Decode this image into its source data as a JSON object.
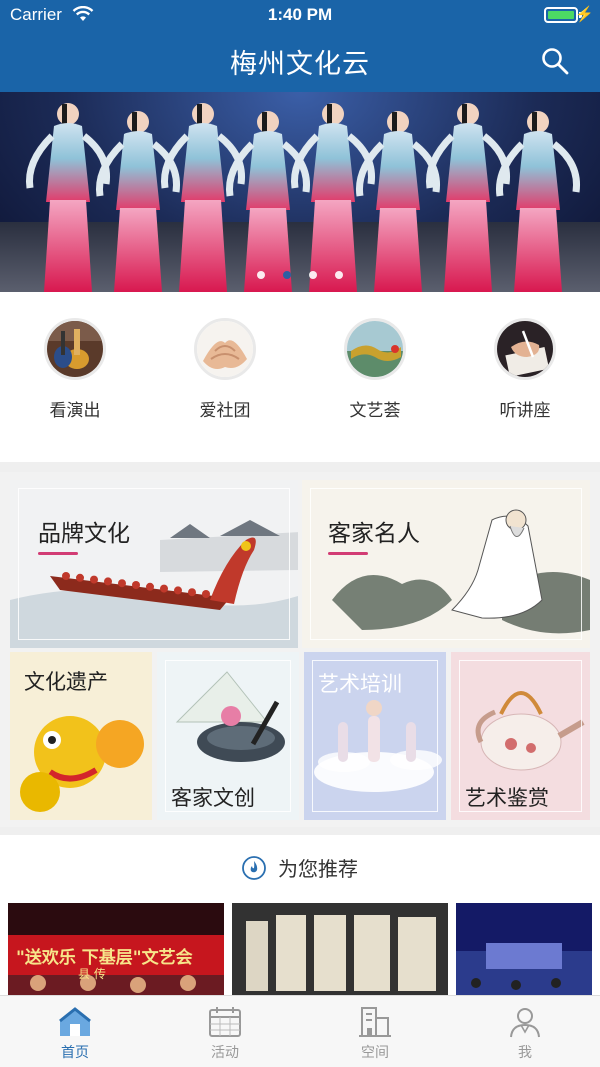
{
  "status_bar": {
    "carrier": "Carrier",
    "time": "1:40 PM",
    "battery_percent": 100
  },
  "header": {
    "title": "梅州文化云",
    "search_icon": "search-icon"
  },
  "banner": {
    "slide_count": 4,
    "active_slide": 2
  },
  "categories": [
    {
      "label": "看演出",
      "icon": "guitar-icon"
    },
    {
      "label": "爱社团",
      "icon": "hands-icon"
    },
    {
      "label": "文艺荟",
      "icon": "dragon-icon"
    },
    {
      "label": "听讲座",
      "icon": "writing-hand-icon"
    }
  ],
  "tiles": [
    {
      "title": "品牌文化"
    },
    {
      "title": "客家名人"
    },
    {
      "title": "文化遗产"
    },
    {
      "title": "客家文创"
    },
    {
      "title": "艺术培训"
    },
    {
      "title": "艺术鉴赏"
    }
  ],
  "recommend": {
    "title": "为您推荐",
    "banner_text": "\"送欢乐 下基层\"文艺会",
    "banner_subtext": "县  传"
  },
  "tabs": [
    {
      "label": "首页",
      "icon": "home-icon",
      "active": true
    },
    {
      "label": "活动",
      "icon": "calendar-icon",
      "active": false
    },
    {
      "label": "空间",
      "icon": "building-icon",
      "active": false
    },
    {
      "label": "我",
      "icon": "user-icon",
      "active": false
    }
  ],
  "colors": {
    "primary": "#1a64a8",
    "accent": "#d23c74",
    "active_tab": "#2a6fb0"
  }
}
